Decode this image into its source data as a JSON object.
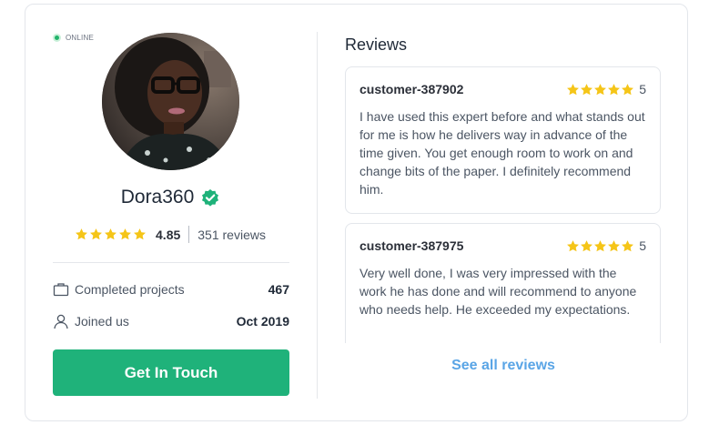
{
  "profile": {
    "status": "ONLINE",
    "name": "Dora360",
    "rating": "4.85",
    "rating_stars": 5,
    "reviews_count": "351 reviews",
    "stats": [
      {
        "icon": "briefcase-icon",
        "label": "Completed projects",
        "value": "467"
      },
      {
        "icon": "user-icon",
        "label": "Joined us",
        "value": "Oct 2019"
      }
    ],
    "cta_label": "Get In Touch"
  },
  "reviews": {
    "title": "Reviews",
    "items": [
      {
        "author": "customer-387902",
        "stars": 5,
        "score": "5",
        "text": "I have used this expert before and what stands out for me is how he delivers way in advance of the time given. You get enough room to work on and change bits of the paper. I definitely recommend him."
      },
      {
        "author": "customer-387975",
        "stars": 5,
        "score": "5",
        "text": "Very well done, I was very impressed with the work he has done and will recommend to anyone who needs help. He exceeded my expectations."
      }
    ],
    "see_all_label": "See all reviews"
  },
  "colors": {
    "accent_green": "#1fb27a",
    "star_yellow": "#f5c518",
    "link_blue": "#5aa5e6",
    "online_green": "#22b36b"
  }
}
